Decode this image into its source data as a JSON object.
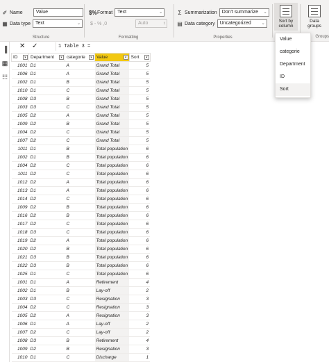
{
  "ribbon": {
    "structure": {
      "name_label": "Name",
      "name_value": "Value",
      "datatype_label": "Data type",
      "datatype_value": "Text",
      "group_label": "Structure"
    },
    "formatting": {
      "format_label": "Format",
      "format_value": "Text",
      "symbols": "$ - % ,0",
      "decimal_value": "Auto",
      "group_label": "Formatting"
    },
    "properties": {
      "summarization_label": "Summarization",
      "summarization_value": "Don't summarize",
      "category_label": "Data category",
      "category_value": "Uncategorized",
      "group_label": "Properties"
    },
    "sort": {
      "label": "Sort by column"
    },
    "groups": {
      "label": "Data groups",
      "group_label": "Groups"
    }
  },
  "formula_bar": {
    "formula": "1 Table 3 ="
  },
  "sort_menu": {
    "items": [
      "Value",
      "categorie",
      "Department",
      "ID",
      "Sort"
    ]
  },
  "table": {
    "headers": [
      "ID",
      "Department",
      "categorie",
      "Value",
      "Sort"
    ],
    "rows": [
      [
        "1001",
        "D1",
        "A",
        "Grand Total",
        "5"
      ],
      [
        "1006",
        "D1",
        "A",
        "Grand Total",
        "5"
      ],
      [
        "1002",
        "D1",
        "B",
        "Grand Total",
        "5"
      ],
      [
        "1010",
        "D1",
        "C",
        "Grand Total",
        "5"
      ],
      [
        "1008",
        "D3",
        "B",
        "Grand Total",
        "5"
      ],
      [
        "1003",
        "D3",
        "C",
        "Grand Total",
        "5"
      ],
      [
        "1005",
        "D2",
        "A",
        "Grand Total",
        "5"
      ],
      [
        "1009",
        "D2",
        "B",
        "Grand Total",
        "5"
      ],
      [
        "1004",
        "D2",
        "C",
        "Grand Total",
        "5"
      ],
      [
        "1007",
        "D2",
        "C",
        "Grand Total",
        "5"
      ],
      [
        "1011",
        "D1",
        "B",
        "Total population",
        "6"
      ],
      [
        "1002",
        "D1",
        "B",
        "Total population",
        "6"
      ],
      [
        "1004",
        "D2",
        "C",
        "Total population",
        "6"
      ],
      [
        "1011",
        "D2",
        "C",
        "Total population",
        "6"
      ],
      [
        "1012",
        "D2",
        "A",
        "Total population",
        "6"
      ],
      [
        "1013",
        "D1",
        "A",
        "Total population",
        "6"
      ],
      [
        "1014",
        "D2",
        "C",
        "Total population",
        "6"
      ],
      [
        "1009",
        "D2",
        "B",
        "Total population",
        "6"
      ],
      [
        "1016",
        "D2",
        "B",
        "Total population",
        "6"
      ],
      [
        "1017",
        "D2",
        "C",
        "Total population",
        "6"
      ],
      [
        "1018",
        "D3",
        "C",
        "Total population",
        "6"
      ],
      [
        "1019",
        "D2",
        "A",
        "Total population",
        "6"
      ],
      [
        "1020",
        "D2",
        "B",
        "Total population",
        "6"
      ],
      [
        "1021",
        "D3",
        "B",
        "Total population",
        "6"
      ],
      [
        "1022",
        "D3",
        "B",
        "Total population",
        "6"
      ],
      [
        "1025",
        "D1",
        "C",
        "Total population",
        "6"
      ],
      [
        "1001",
        "D1",
        "A",
        "Retirement",
        "4"
      ],
      [
        "1002",
        "D1",
        "B",
        "Lay-off",
        "2"
      ],
      [
        "1003",
        "D3",
        "C",
        "Resignation",
        "3"
      ],
      [
        "1004",
        "D2",
        "C",
        "Resignation",
        "3"
      ],
      [
        "1005",
        "D2",
        "A",
        "Resignation",
        "3"
      ],
      [
        "1006",
        "D1",
        "A",
        "Lay-off",
        "2"
      ],
      [
        "1007",
        "D2",
        "C",
        "Lay-off",
        "2"
      ],
      [
        "1008",
        "D3",
        "B",
        "Retirement",
        "4"
      ],
      [
        "1009",
        "D2",
        "B",
        "Resignation",
        "3"
      ],
      [
        "1010",
        "D1",
        "C",
        "Discharge",
        "1"
      ]
    ]
  }
}
